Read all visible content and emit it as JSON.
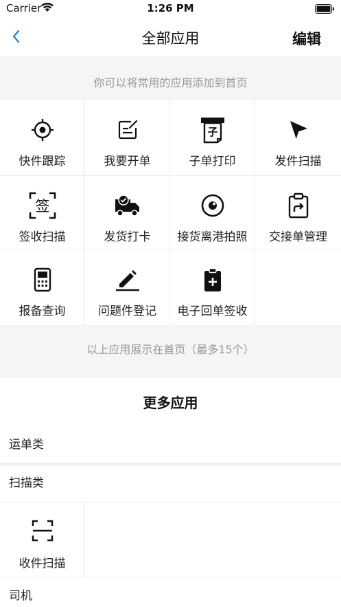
{
  "status": {
    "carrier": "Carrier",
    "time": "1:26 PM"
  },
  "nav": {
    "title": "全部应用",
    "edit_label": "编辑"
  },
  "hints": {
    "top": "你可以将常用的应用添加到首页",
    "bottom": "以上应用展示在首页（最多15个）"
  },
  "apps": [
    {
      "label": "快件跟踪",
      "icon": "target-icon"
    },
    {
      "label": "我要开单",
      "icon": "edit-form-icon"
    },
    {
      "label": "子单打印",
      "icon": "printer-icon"
    },
    {
      "label": "发件扫描",
      "icon": "send-arrow-icon"
    },
    {
      "label": "签收扫描",
      "icon": "sign-scan-icon"
    },
    {
      "label": "发货打卡",
      "icon": "truck-check-icon"
    },
    {
      "label": "接货离港拍照",
      "icon": "camera-lens-icon"
    },
    {
      "label": "交接单管理",
      "icon": "clipboard-share-icon"
    },
    {
      "label": "报备查询",
      "icon": "handheld-device-icon"
    },
    {
      "label": "问题件登记",
      "icon": "pencil-line-icon"
    },
    {
      "label": "电子回单签收",
      "icon": "clipboard-plus-icon"
    }
  ],
  "more": {
    "title": "更多应用",
    "categories": [
      "运单类",
      "扫描类",
      "司机"
    ],
    "scan_apps": [
      {
        "label": "收件扫描",
        "icon": "scan-frame-icon"
      }
    ]
  }
}
